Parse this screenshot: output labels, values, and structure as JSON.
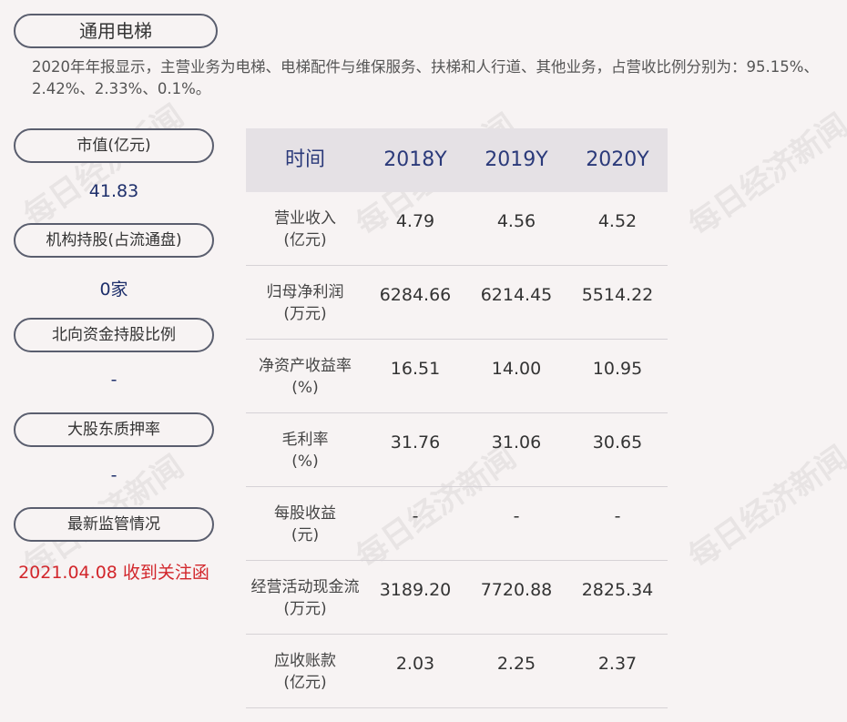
{
  "company": "通用电梯",
  "summary": "2020年年报显示，主营业务为电梯、电梯配件与维保服务、扶梯和人行道、其他业务，占营收比例分别为：95.15%、2.42%、2.33%、0.1%。",
  "sidebar": {
    "items": [
      {
        "label": "市值(亿元)",
        "value": "41.83"
      },
      {
        "label": "机构持股(占流通盘)",
        "value": "0家"
      },
      {
        "label": "北向资金持股比例",
        "value": "-"
      },
      {
        "label": "大股东质押率",
        "value": "-"
      },
      {
        "label": "最新监管情况",
        "value": "2021.04.08 收到关注函"
      }
    ]
  },
  "table": {
    "headers": [
      "时间",
      "2018Y",
      "2019Y",
      "2020Y"
    ],
    "rows": [
      {
        "label_line1": "营业收入",
        "label_line2": "(亿元)",
        "values": [
          "4.79",
          "4.56",
          "4.52"
        ]
      },
      {
        "label_line1": "归母净利润",
        "label_line2": "(万元)",
        "values": [
          "6284.66",
          "6214.45",
          "5514.22"
        ]
      },
      {
        "label_line1": "净资产收益率",
        "label_line2": "(%)",
        "values": [
          "16.51",
          "14.00",
          "10.95"
        ]
      },
      {
        "label_line1": "毛利率",
        "label_line2": "(%)",
        "values": [
          "31.76",
          "31.06",
          "30.65"
        ]
      },
      {
        "label_line1": "每股收益",
        "label_line2": "(元)",
        "values": [
          "-",
          "-",
          "-"
        ]
      },
      {
        "label_line1": "经营活动现金流",
        "label_line2": "(万元)",
        "values": [
          "3189.20",
          "7720.88",
          "2825.34"
        ]
      },
      {
        "label_line1": "应收账款",
        "label_line2": "(亿元)",
        "values": [
          "2.03",
          "2.25",
          "2.37"
        ]
      }
    ]
  },
  "watermark": "每日经济新闻",
  "colors": {
    "accent": "#2b3a7a",
    "alert": "#d2262b",
    "header_bg": "#e5e1e5",
    "page_bg": "#f7f3f3"
  }
}
